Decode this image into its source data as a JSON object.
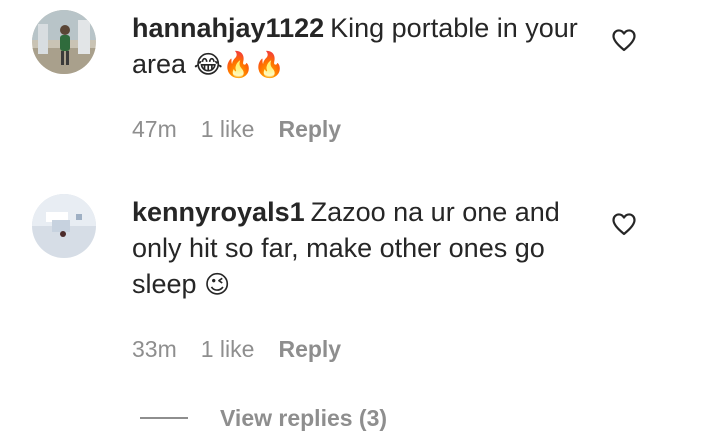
{
  "comments": [
    {
      "username": "hannahjay1122",
      "text": "King portable in your area",
      "emojis": "😂🔥🔥",
      "time": "47m",
      "likes": "1 like",
      "reply_label": "Reply",
      "avatar_icon": "profile-photo-avatar"
    },
    {
      "username": "kennyroyals1",
      "text": "Zazoo na ur one and only hit so far, make other ones go sleep",
      "emojis": "😉",
      "time": "33m",
      "likes": "1 like",
      "reply_label": "Reply",
      "avatar_icon": "profile-photo-avatar"
    }
  ],
  "view_replies": {
    "label": "View replies (3)"
  },
  "icons": {
    "like": "heart-icon"
  },
  "colors": {
    "text": "#262626",
    "secondary": "#8e8e8e",
    "background": "#ffffff"
  }
}
